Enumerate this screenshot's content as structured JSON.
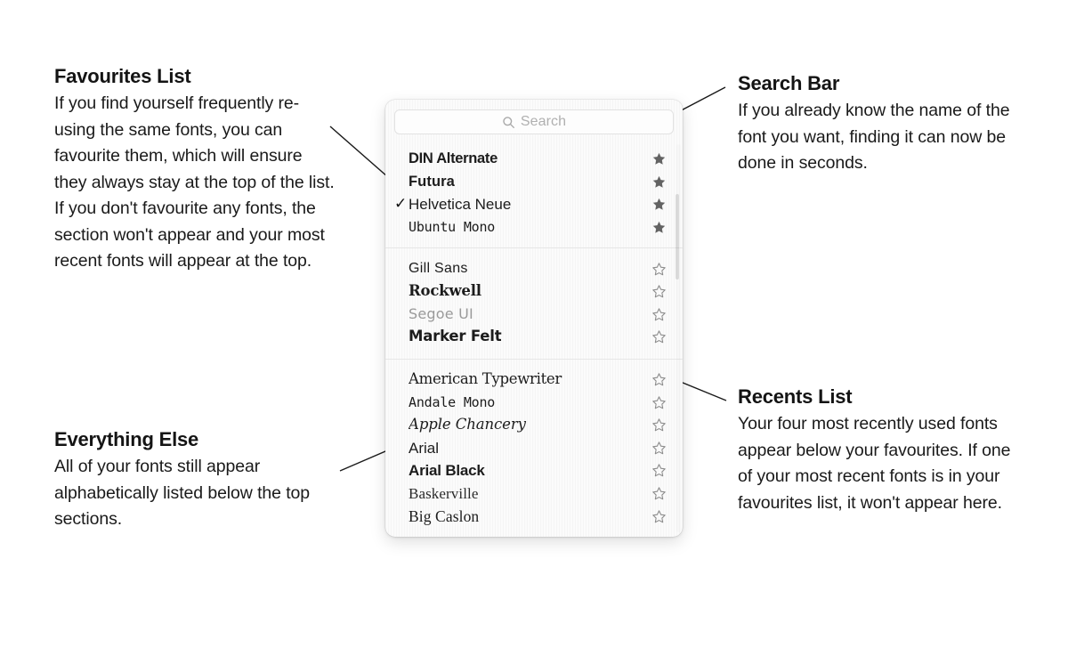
{
  "annotations": {
    "favourites": {
      "title": "Favourites List",
      "body": "If you find yourself frequently re-using the same fonts, you can favourite them, which will ensure they always stay at the top of the list. If you don't favourite any fonts, the section won't appear and your most recent fonts will appear at the top."
    },
    "everything_else": {
      "title": "Everything Else",
      "body": "All of your fonts still appear alphabetically listed below the top sections."
    },
    "search_bar": {
      "title": "Search Bar",
      "body": "If you already know the name of the font you want, finding it can now be done in seconds."
    },
    "recents": {
      "title": "Recents List",
      "body": "Your four most recently used fonts appear below your favourites. If one of your most recent fonts is in your favourites list, it won't appear here."
    }
  },
  "font_picker": {
    "search": {
      "placeholder": "Search",
      "value": "",
      "icon": "search-icon"
    },
    "sections": [
      {
        "id": "favourites",
        "rows": [
          {
            "name": "DIN Alternate",
            "spec": "spec-din",
            "checked": false,
            "star": "filled"
          },
          {
            "name": "Futura",
            "spec": "spec-futura",
            "checked": false,
            "star": "filled"
          },
          {
            "name": "Helvetica Neue",
            "spec": "spec-helvetica",
            "checked": true,
            "star": "filled"
          },
          {
            "name": "Ubuntu Mono",
            "spec": "spec-ubuntu",
            "checked": false,
            "star": "filled"
          }
        ]
      },
      {
        "id": "recents",
        "rows": [
          {
            "name": "Gill Sans",
            "spec": "spec-gillsans",
            "checked": false,
            "star": "hollow"
          },
          {
            "name": "Rockwell",
            "spec": "spec-rockwell",
            "checked": false,
            "star": "hollow"
          },
          {
            "name": "Segoe UI",
            "spec": "spec-segoe",
            "checked": false,
            "star": "hollow"
          },
          {
            "name": "Marker Felt",
            "spec": "spec-marker",
            "checked": false,
            "star": "hollow"
          }
        ]
      },
      {
        "id": "all-fonts",
        "rows": [
          {
            "name": "American Typewriter",
            "spec": "spec-amtype",
            "checked": false,
            "star": "hollow"
          },
          {
            "name": "Andale Mono",
            "spec": "spec-andale",
            "checked": false,
            "star": "hollow"
          },
          {
            "name": "Apple Chancery",
            "spec": "spec-chancery",
            "checked": false,
            "star": "hollow"
          },
          {
            "name": "Arial",
            "spec": "spec-arial",
            "checked": false,
            "star": "hollow"
          },
          {
            "name": "Arial Black",
            "spec": "spec-arialblk",
            "checked": false,
            "star": "hollow"
          },
          {
            "name": "Baskerville",
            "spec": "spec-baskerv",
            "checked": false,
            "star": "hollow"
          },
          {
            "name": "Big Caslon",
            "spec": "spec-bigcaslon",
            "checked": false,
            "star": "hollow"
          }
        ]
      }
    ],
    "checkmark_glyph": "✓"
  },
  "colors": {
    "background": "#ffffff",
    "panel": "#fbfbfb",
    "text": "#1a1a1a",
    "star_filled": "#636363",
    "star_hollow_outline": "#8c8c8c",
    "placeholder": "#b0b0b0",
    "divider": "#e6e6e6",
    "leader_line": "#1a1a1a"
  }
}
